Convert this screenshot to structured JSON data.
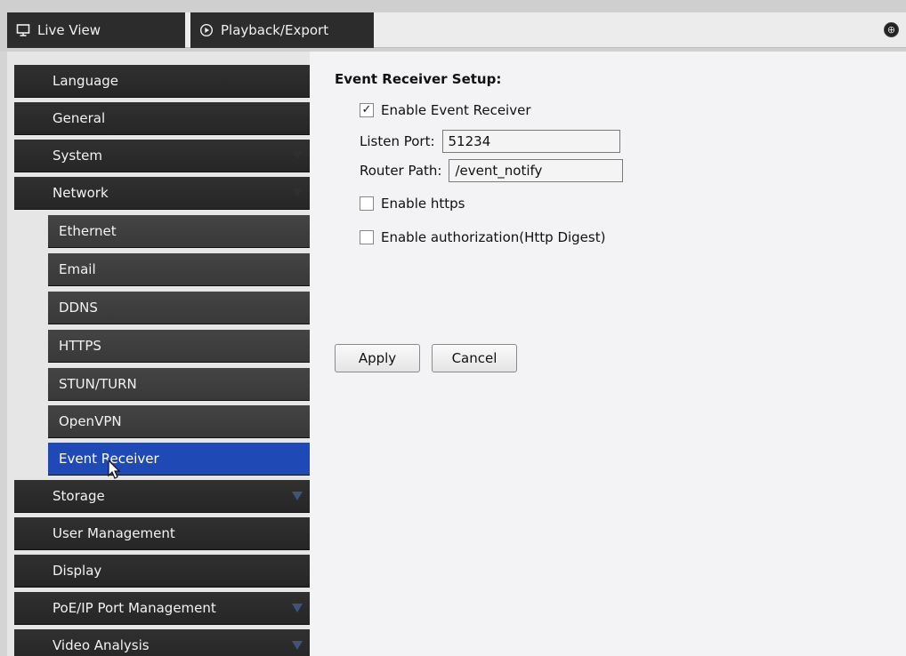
{
  "tabs": {
    "live_view": "Live View",
    "playback": "Playback/Export"
  },
  "sidebar": {
    "items": [
      {
        "label": "Language"
      },
      {
        "label": "General"
      },
      {
        "label": "System"
      },
      {
        "label": "Network"
      },
      {
        "label": "Ethernet"
      },
      {
        "label": "Email"
      },
      {
        "label": "DDNS"
      },
      {
        "label": "HTTPS"
      },
      {
        "label": "STUN/TURN"
      },
      {
        "label": "OpenVPN"
      },
      {
        "label": "Event Receiver"
      },
      {
        "label": "Storage"
      },
      {
        "label": "User Management"
      },
      {
        "label": "Display"
      },
      {
        "label": "PoE/IP Port Management"
      },
      {
        "label": "Video Analysis"
      }
    ],
    "active": "Event Receiver"
  },
  "main": {
    "title": "Event Receiver Setup:",
    "enable_event_receiver": {
      "label": "Enable Event Receiver",
      "checked": true
    },
    "listen_port": {
      "label": "Listen Port:",
      "value": "51234"
    },
    "router_path": {
      "label": "Router Path:",
      "value": "/event_notify"
    },
    "enable_https": {
      "label": "Enable https",
      "checked": false
    },
    "enable_authorization": {
      "label": "Enable authorization(Http Digest)",
      "checked": false
    },
    "apply_label": "Apply",
    "cancel_label": "Cancel"
  },
  "colors": {
    "active_item": "#1f49b5",
    "sidebar_item": "#2b2b2b",
    "sub_item": "#404040"
  },
  "icons": {
    "live_view": "monitor-icon",
    "playback": "play-circle-icon",
    "globe": "globe-icon",
    "expand": "triangle-down-icon"
  }
}
